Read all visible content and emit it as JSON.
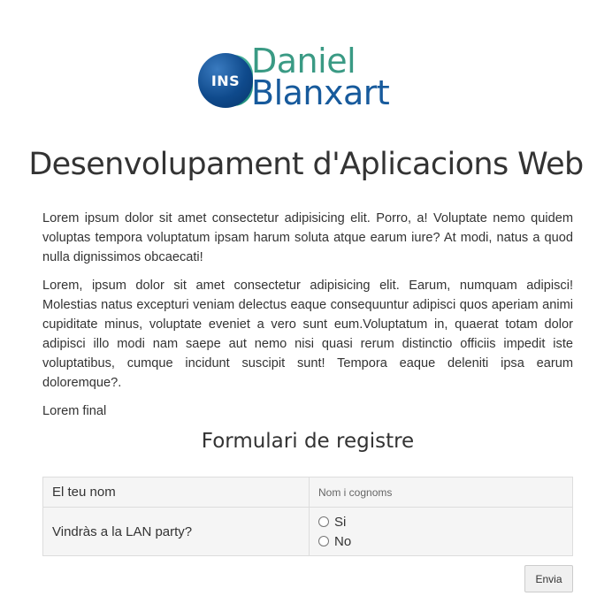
{
  "logo": {
    "badge_text": "INS",
    "line1": "Daniel",
    "line2": "Blanxart"
  },
  "page_title": "Desenvolupament d'Aplicacions Web",
  "paragraphs": [
    "Lorem ipsum dolor sit amet consectetur adipisicing elit. Porro, a! Voluptate nemo quidem voluptas tempora voluptatum ipsam harum soluta atque earum iure? At modi, natus a quod nulla dignissimos obcaecati!",
    "Lorem, ipsum dolor sit amet consectetur adipisicing elit. Earum, numquam adipisci! Molestias natus excepturi veniam delectus eaque consequuntur adipisci quos aperiam animi cupiditate minus, voluptate eveniet a vero sunt eum.Voluptatum in, quaerat totam dolor adipisci illo modi nam saepe aut nemo nisi quasi rerum distinctio officiis impedit iste voluptatibus, cumque incidunt suscipit sunt! Tempora eaque deleniti ipsa earum doloremque?.",
    "Lorem final"
  ],
  "form": {
    "title": "Formulari de registre",
    "name_label": "El teu nom",
    "name_value": "",
    "name_placeholder": "Nom i cognoms",
    "lan_label": "Vindràs a la LAN party?",
    "options": [
      "Si",
      "No"
    ],
    "selected_option": null,
    "submit_label": "Envia"
  },
  "colors": {
    "logo_teal": "#3a9a84",
    "logo_blue": "#175a9c",
    "table_background": "#f5f5f5",
    "border": "#dddddd"
  }
}
